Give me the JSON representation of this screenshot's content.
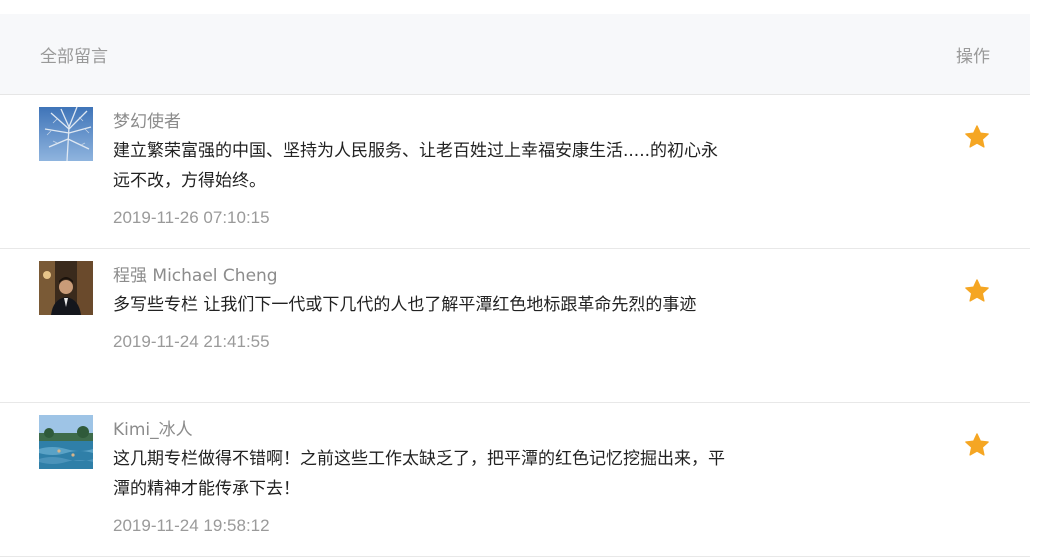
{
  "header": {
    "title": "全部留言",
    "action": "操作"
  },
  "star_color": "#f5a623",
  "comments": [
    {
      "name": "梦幻使者",
      "text": "建立繁荣富强的中国、坚持为人民服务、让老百姓过上幸福安康生活.....的初心永远不改，方得始终。",
      "time": "2019-11-26 07:10:15",
      "avatar": "tree-photo",
      "action_icon": "star-icon"
    },
    {
      "name": "程强 Michael Cheng",
      "text": "多写些专栏 让我们下一代或下几代的人也了解平潭红色地标跟革命先烈的事迹",
      "time": "2019-11-24 21:41:55",
      "avatar": "portrait-photo",
      "action_icon": "star-icon"
    },
    {
      "name": "Kimi_冰人",
      "text": "这几期专栏做得不错啊！之前这些工作太缺乏了，把平潭的红色记忆挖掘出来，平潭的精神才能传承下去！",
      "time": "2019-11-24 19:58:12",
      "avatar": "seaside-photo",
      "action_icon": "star-icon"
    }
  ]
}
